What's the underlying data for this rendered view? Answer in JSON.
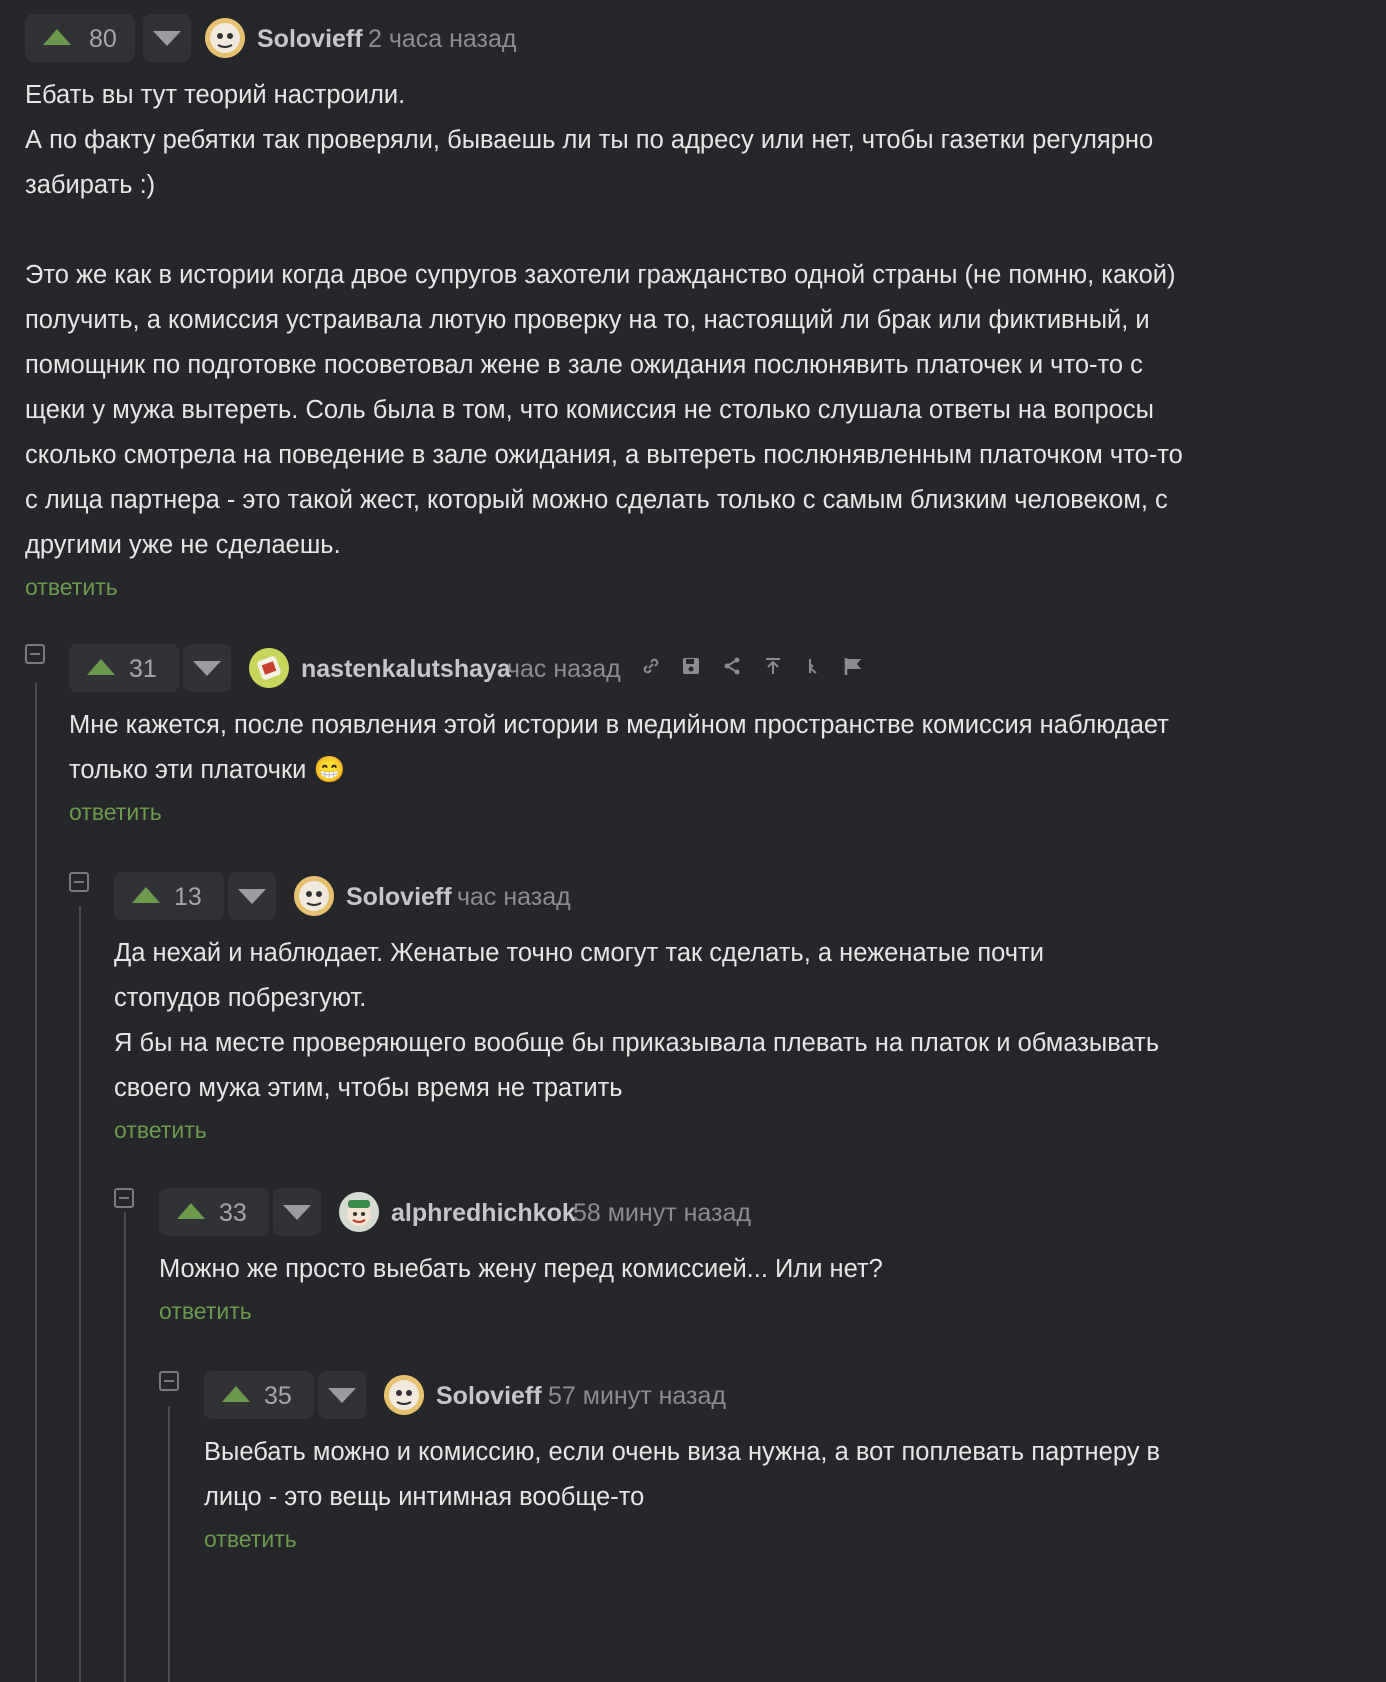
{
  "comments": [
    {
      "score": "80",
      "author": "Solovieff",
      "time": "2 часа назад",
      "text": "Ебать вы тут теорий настроили.\nА по факту ребятки так проверяли, бываешь ли ты по адресу или нет, чтобы газетки регулярно\nзабирать :)\n\nЭто же как в истории когда двое супругов захотели гражданство одной страны (не помню, какой)\nполучить, а комиссия устраивала лютую проверку на то, настоящий ли брак или фиктивный, и\nпомощник по подготовке посоветовал жене в зале ожидания послюнявить платочек и что-то с\nщеки у мужа вытереть. Соль была в том, что комиссия не столько слушала ответы на вопросы\nсколько смотрела на поведение в зале ожидания, а вытереть послюнявленным платочком что-то\nс лица партнера - это такой жест, который можно сделать только с самым близким человеком, с\nдругими уже не сделаешь.",
      "reply": "ответить"
    },
    {
      "score": "31",
      "author": "nastenkalutshaya",
      "time": "час назад",
      "text": "Мне кажется, после появления этой истории в медийном пространстве комиссия наблюдает\nтолько эти платочки 😁",
      "reply": "ответить",
      "actions": [
        "link-icon",
        "save-icon",
        "share-icon",
        "go-to-parent-icon",
        "thread-icon",
        "flag-icon"
      ]
    },
    {
      "score": "13",
      "author": "Solovieff",
      "time": "час назад",
      "text": "Да нехай и наблюдает. Женатые точно смогут так сделать, а неженатые почти\nстопудов побрезгуют.\nЯ бы на месте проверяющего вообще бы приказывала плевать на платок и обмазывать\nсвоего мужа этим, чтобы время не тратить",
      "reply": "ответить"
    },
    {
      "score": "33",
      "author": "alphredhichkok",
      "time": "58 минут назад",
      "text": "Можно же просто выебать жену перед комиссией... Или нет?",
      "reply": "ответить"
    },
    {
      "score": "35",
      "author": "Solovieff",
      "time": "57 минут назад",
      "text": "Выебать можно и комиссию, если очень виза нужна, а вот поплевать партнеру в\nлицо - это вещь интимная вообще-то",
      "reply": "ответить"
    }
  ],
  "colors": {
    "background": "#25272b",
    "upvote": "#6c9a4c",
    "reply_link": "#6c9a4c",
    "muted": "#8b8c90"
  }
}
